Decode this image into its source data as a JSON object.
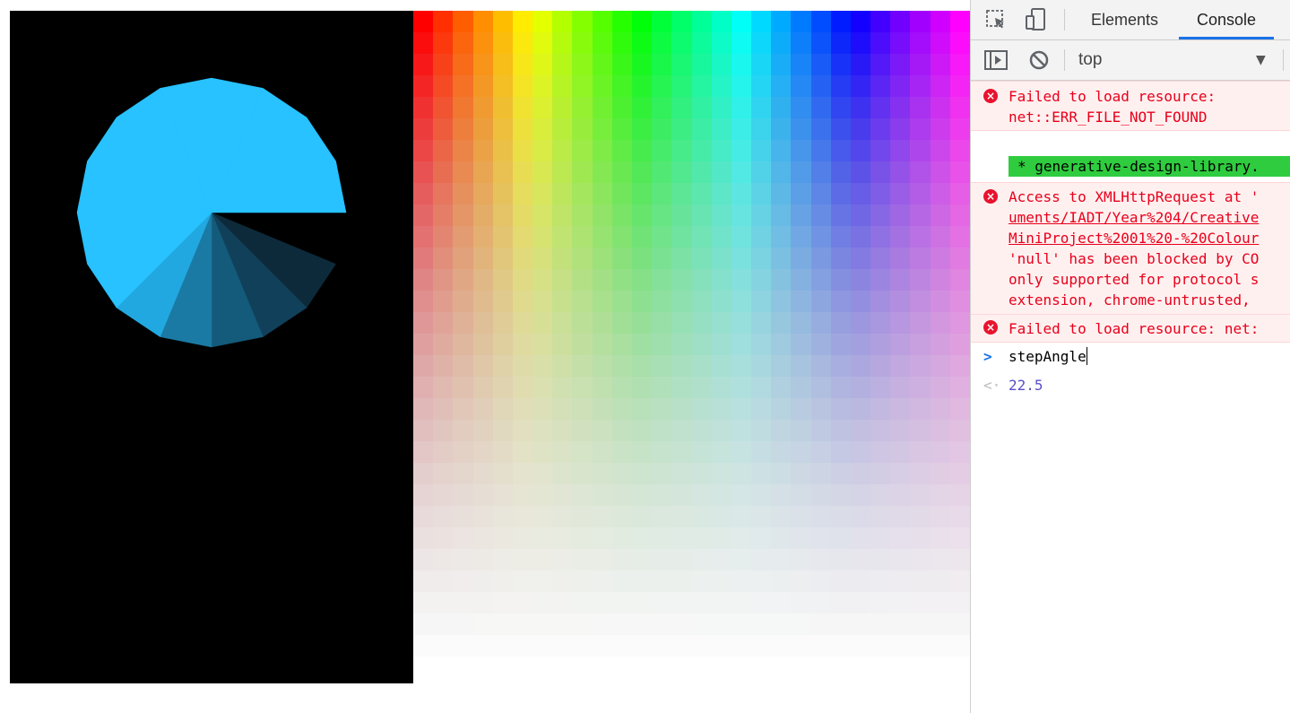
{
  "canvas": {
    "background": "#000000",
    "pie": {
      "segments": 16,
      "step_angle_deg": 22.5,
      "main_color": "#27c2ff",
      "shaded_colors": [
        "#0d2a3a",
        "#11405a",
        "#145a7a",
        "#1a7aa4",
        "#22a8e0"
      ]
    }
  },
  "color_grid": {
    "columns": 28,
    "rows": 31
  },
  "devtools": {
    "tabs": [
      {
        "label": "Elements"
      },
      {
        "label": "Console"
      }
    ],
    "toolbar": {
      "context": "top",
      "context_arrow": "▼"
    },
    "messages": {
      "error1": {
        "line1": "Failed to load resource:",
        "line2": "net::ERR_FILE_NOT_FOUND"
      },
      "log1": "* generative-design-library.",
      "error2": {
        "line1": "Access to XMLHttpRequest at '",
        "line2": "uments/IADT/Year%204/Creative",
        "line3": "MiniProject%2001%20-%20Colour",
        "line4": "'null' has been blocked by CO",
        "line5": "only supported for protocol s",
        "line6": "extension, chrome-untrusted,"
      },
      "error3": "Failed to load resource: net:",
      "input": "stepAngle",
      "result": "22.5"
    },
    "colors": {
      "error_text": "#e8001a",
      "result_value": "#5a4fc8",
      "active_tab": "#1a73e8"
    }
  }
}
